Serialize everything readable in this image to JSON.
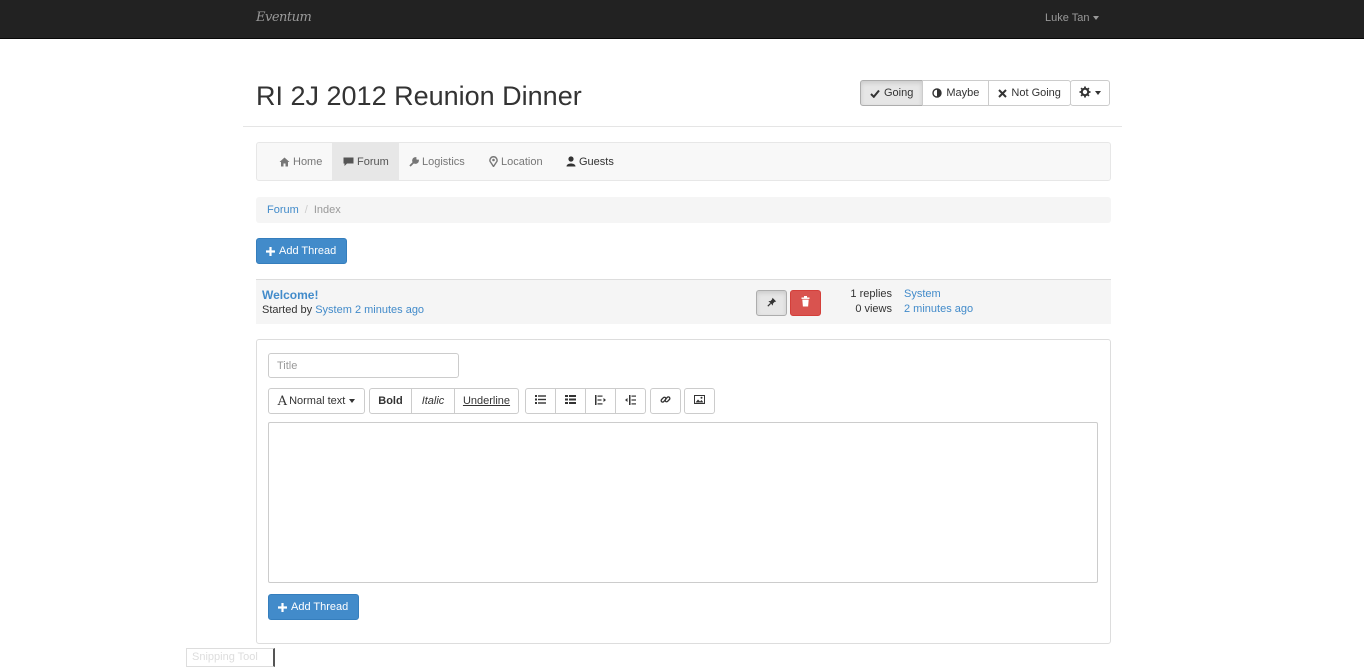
{
  "app": {
    "brand": "Eventum",
    "user": "Luke Tan"
  },
  "event": {
    "title": "RI 2J 2012 Reunion Dinner"
  },
  "rsvp": {
    "going": "Going",
    "maybe": "Maybe",
    "not_going": "Not Going"
  },
  "subnav": {
    "items": [
      {
        "label": "Home",
        "icon": "home-icon"
      },
      {
        "label": "Forum",
        "icon": "comment-icon",
        "active": true
      },
      {
        "label": "Logistics",
        "icon": "wrench-icon"
      },
      {
        "label": "Location",
        "icon": "map-marker-icon"
      },
      {
        "label": "Guests",
        "icon": "user-icon"
      }
    ]
  },
  "breadcrumb": {
    "link": "Forum",
    "separator": "/",
    "current": "Index"
  },
  "actions": {
    "add_thread": "Add Thread"
  },
  "threads": [
    {
      "title": "Welcome!",
      "started_by_prefix": "Started by",
      "author": "System",
      "time": "2 minutes ago",
      "replies": "1 replies",
      "views": "0 views",
      "last_author": "System",
      "last_time": "2 minutes ago"
    }
  ],
  "composer": {
    "title_placeholder": "Title",
    "format_dropdown": "Normal text",
    "bold": "Bold",
    "italic": "Italic",
    "underline": "Underline",
    "submit": "Add Thread"
  },
  "overlay": {
    "snipping_tool": "Snipping Tool"
  },
  "colors": {
    "primary": "#428bca",
    "danger": "#d9534f",
    "navbar": "#222222"
  }
}
